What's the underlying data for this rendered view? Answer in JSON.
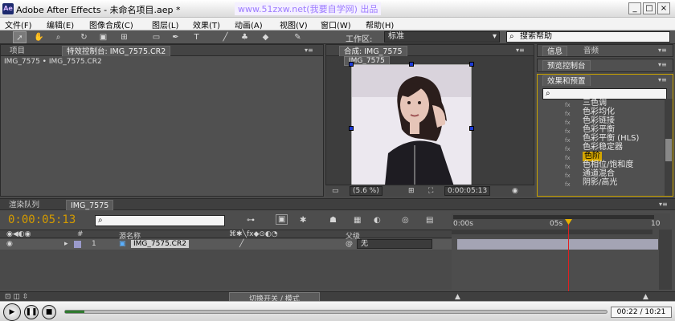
{
  "window": {
    "title": "Adobe After Effects - 未命名项目.aep *",
    "watermark": "www.51zxw.net(我要自学网) 出品",
    "buttons": {
      "minimize": "_",
      "maximize": "□",
      "close": "×"
    }
  },
  "menubar": {
    "items": [
      "文件(F)",
      "编辑(E)",
      "图像合成(C)",
      "图层(L)",
      "效果(T)",
      "动画(A)",
      "视图(V)",
      "窗口(W)",
      "帮助(H)"
    ]
  },
  "toolbar": {
    "workspace_label": "工作区:",
    "workspace_value": "标准",
    "search_placeholder": "搜索帮助"
  },
  "project_panel": {
    "tabs": [
      "项目",
      "特效控制台: IMG_7575.CR2"
    ],
    "breadcrumb": "IMG_7575 • IMG_7575.CR2"
  },
  "composition_panel": {
    "tab": "合成: IMG_7575",
    "comp_name_tab": "IMG_7575",
    "zoom": "(5.6 %)",
    "timecode": "0:00:05:13"
  },
  "info_panel": {
    "tabs": [
      "信息",
      "音频"
    ]
  },
  "preview_panel": {
    "tab": "预览控制台"
  },
  "effects_panel": {
    "tab": "效果和预置",
    "search_placeholder": "",
    "items": [
      "三色调",
      "色彩均化",
      "色彩链接",
      "色彩平衡",
      "色彩平衡 (HLS)",
      "色彩稳定器",
      "色阶",
      "色相位/饱和度",
      "通道混合",
      "阴影/高光"
    ],
    "highlighted_index": 6,
    "highlighted_text": "色阶"
  },
  "timeline": {
    "tabs": [
      "渲染队列",
      "IMG_7575"
    ],
    "current_time": "0:00:05:13",
    "search_placeholder": "",
    "columns": {
      "num": "#",
      "layer_name": "源名称",
      "parent": "父级"
    },
    "layer": {
      "number": "1",
      "name": "IMG_7575.CR2",
      "parent": "无"
    },
    "ruler": {
      "start": "0:00s",
      "mid": "05s",
      "end": "10"
    },
    "mode_switch": "切换开关 / 模式"
  },
  "player": {
    "time": "00:22 / 10:21",
    "progress": 0.035
  }
}
